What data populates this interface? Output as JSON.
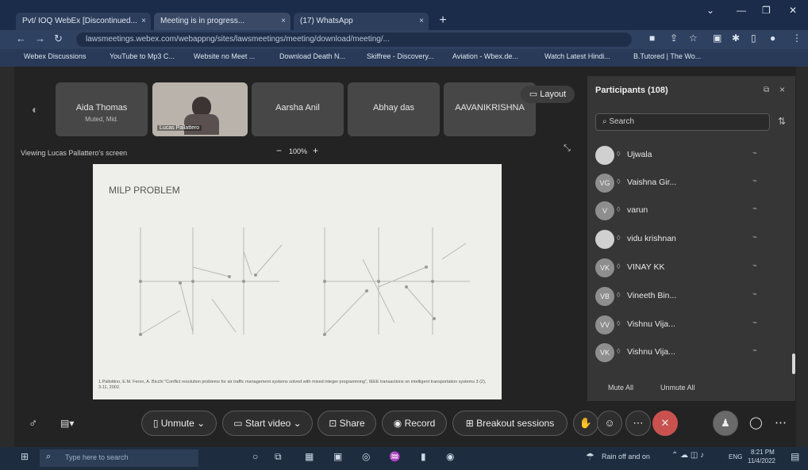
{
  "browser": {
    "tabs": [
      {
        "label": "Pvt/ IOQ WebEx [Discontinued..."
      },
      {
        "label": "Meeting is in progress..."
      },
      {
        "label": "(17) WhatsApp"
      }
    ],
    "new_tab": "+",
    "url": "lawsmeetings.webex.com/webappng/sites/lawsmeetings/meeting/download/meeting/...",
    "bookmarks": [
      "Webex Discussions",
      "YouTube to Mp3 C...",
      "Website no Meet ...",
      "Download Death N...",
      "Skiffree - Discovery...",
      "Aviation - Wbex.de...",
      "Watch Latest Hindi...",
      "B.Tutored | The Wo..."
    ]
  },
  "meeting": {
    "thumbnails": [
      {
        "name": "Aida Thomas",
        "status": "Muted, Mid."
      },
      {
        "name": "Lucas Pallattero"
      },
      {
        "name": "Aarsha Anil"
      },
      {
        "name": "Abhay das"
      },
      {
        "name": "AAVANIKRISHNA"
      }
    ],
    "layout_label": "Layout",
    "viewing_label": "Viewing Lucas Pallattero's screen",
    "zoom": {
      "minus": "−",
      "value": "100%",
      "plus": "+"
    },
    "slide": {
      "title": "MILP PROBLEM",
      "reference": "1.Pallottino, E.M. Feron, A. Bicchi \"Conflict resolution problems for air traffic management systems solved with mixed integer programming\", IEEE transactions on intelligent transportation systems 3 (2), 3-11, 2002."
    }
  },
  "participants": {
    "title": "Participants (108)",
    "search_placeholder": "Search",
    "list": [
      {
        "name": "Ujwala",
        "initials": "",
        "light": true
      },
      {
        "name": "Vaishna Gir...",
        "initials": "VG",
        "light": false
      },
      {
        "name": "varun",
        "initials": "V",
        "light": false
      },
      {
        "name": "vidu krishnan",
        "initials": "",
        "light": true
      },
      {
        "name": "VINAY KK",
        "initials": "VK",
        "light": false
      },
      {
        "name": "Vineeth Bin...",
        "initials": "VB",
        "light": false
      },
      {
        "name": "Vishnu Vija...",
        "initials": "VV",
        "light": false
      },
      {
        "name": "Vishnu Vija...",
        "initials": "VK",
        "light": false
      }
    ],
    "mute_all": "Mute All",
    "unmute_all": "Unmute All"
  },
  "controls": {
    "unmute": "Unmute",
    "start_video": "Start video",
    "share": "Share",
    "record": "Record",
    "breakout": "Breakout sessions"
  },
  "taskbar": {
    "search_placeholder": "Type here to search",
    "weather": "Rain off and on",
    "language": "ENG",
    "time": "8:21 PM",
    "date": "11/4/2022"
  }
}
